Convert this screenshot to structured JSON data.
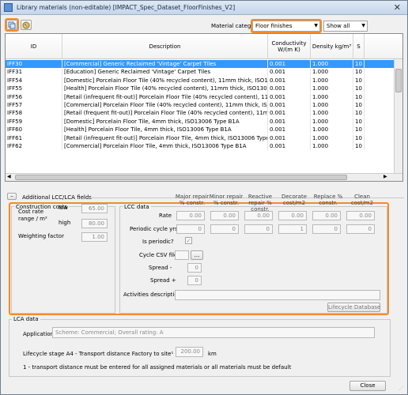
{
  "window": {
    "title": "Library materials (non-editable) [IMPACT_Spec_Dataset_FloorFinishes_V2]",
    "close": "✕"
  },
  "toolbar": {
    "material_category_label": "Material category",
    "material_category_value": "Floor finishes",
    "show_value": "Show all"
  },
  "grid": {
    "headers": [
      "ID",
      "Description",
      "Conductivity W/(m K)",
      "Density kg/m³",
      "S"
    ],
    "rows": [
      [
        "IFF30",
        "[Commercial] Generic Reclaimed 'Vintage' Carpet Tiles",
        "0.001",
        "1.000",
        "10"
      ],
      [
        "IFF31",
        "[Education] Generic Reclaimed 'Vintage' Carpet Tiles",
        "0.001",
        "1.000",
        "10"
      ],
      [
        "IFF54",
        "[Domestic] Porcelain Floor Tile (40% recycled content), 11mm thick, ISO13006 Type B1A",
        "0.001",
        "1.000",
        "10"
      ],
      [
        "IFF55",
        "[Health] Porcelain Floor Tile (40% recycled content), 11mm thick, ISO13006 Type B1A",
        "0.001",
        "1.000",
        "10"
      ],
      [
        "IFF56",
        "[Retail (infrequent fit-out)] Porcelain Floor Tile (40% recycled content), 11mm thick, ISO...",
        "0.001",
        "1.000",
        "10"
      ],
      [
        "IFF57",
        "[Commercial] Porcelain Floor Tile (40% recycled content), 11mm thick, ISO13006 Type B1A",
        "0.001",
        "1.000",
        "10"
      ],
      [
        "IFF58",
        "[Retail (frequent fit-out)] Porcelain Floor Tile (40% recycled content), 11mm thick, ISO13...",
        "0.001",
        "1.000",
        "10"
      ],
      [
        "IFF59",
        "[Domestic] Porcelain Floor Tile, 4mm thick, ISO13006 Type B1A",
        "0.001",
        "1.000",
        "10"
      ],
      [
        "IFF60",
        "[Health] Porcelain Floor Tile, 4mm thick, ISO13006 Type B1A",
        "0.001",
        "1.000",
        "10"
      ],
      [
        "IFF61",
        "[Retail (infrequent fit-out)] Porcelain Floor Tile, 4mm thick, ISO13006 Type B1A",
        "0.001",
        "1.000",
        "10"
      ],
      [
        "IFF62",
        "[Commercial] Porcelain Floor Tile, 4mm thick, ISO13006 Type B1A",
        "0.001",
        "1.000",
        "10"
      ]
    ]
  },
  "additional": {
    "toggle": "–",
    "label": "Additional LCC/LCA fields"
  },
  "construction": {
    "title": "Construction costs",
    "cost_rate_label": "Cost rate range / m²",
    "low_label": "low",
    "low_value": "65.00",
    "high_label": "high",
    "high_value": "80.00",
    "weighting_label": "Weighting factor",
    "weighting_value": "1.00"
  },
  "lcc": {
    "title": "LCC data",
    "col_headers": [
      "Major repair % constr.",
      "Minor repair % constr.",
      "Reactive repair % constr.",
      "Decorate cost/m2",
      "Replace % constr.",
      "Clean cost/m2"
    ],
    "rate_label": "Rate",
    "rate_values": [
      "0.00",
      "0.00",
      "0.00",
      "0.00",
      "0.00",
      "0.00"
    ],
    "cycle_label": "Periodic cycle yrs",
    "cycle_values": [
      "0",
      "0",
      "0",
      "1",
      "0",
      "0"
    ],
    "periodic_label": "Is periodic?",
    "periodic_check": "✓",
    "csv_label": "Cycle CSV file",
    "browse_label": "...",
    "spread_minus_label": "Spread -",
    "spread_minus_value": "0",
    "spread_plus_label": "Spread +",
    "spread_plus_value": "0",
    "activities_label": "Activities description",
    "lifecycle_button": "Lifecycle Database"
  },
  "lca": {
    "title": "LCA data",
    "application_label": "Application",
    "application_value": "Scheme: Commercial; Overall rating: A",
    "transport_label": "Lifecycle stage A4 - Transport distance Factory to site¹",
    "transport_value": "200.00",
    "transport_unit": "km",
    "footnote": "1 - transport distance must be entered for all assigned materials or all materials must be default"
  },
  "footer": {
    "close_label": "Close"
  },
  "colors": {
    "highlight": "#f38c26",
    "selection": "#3399ff"
  }
}
